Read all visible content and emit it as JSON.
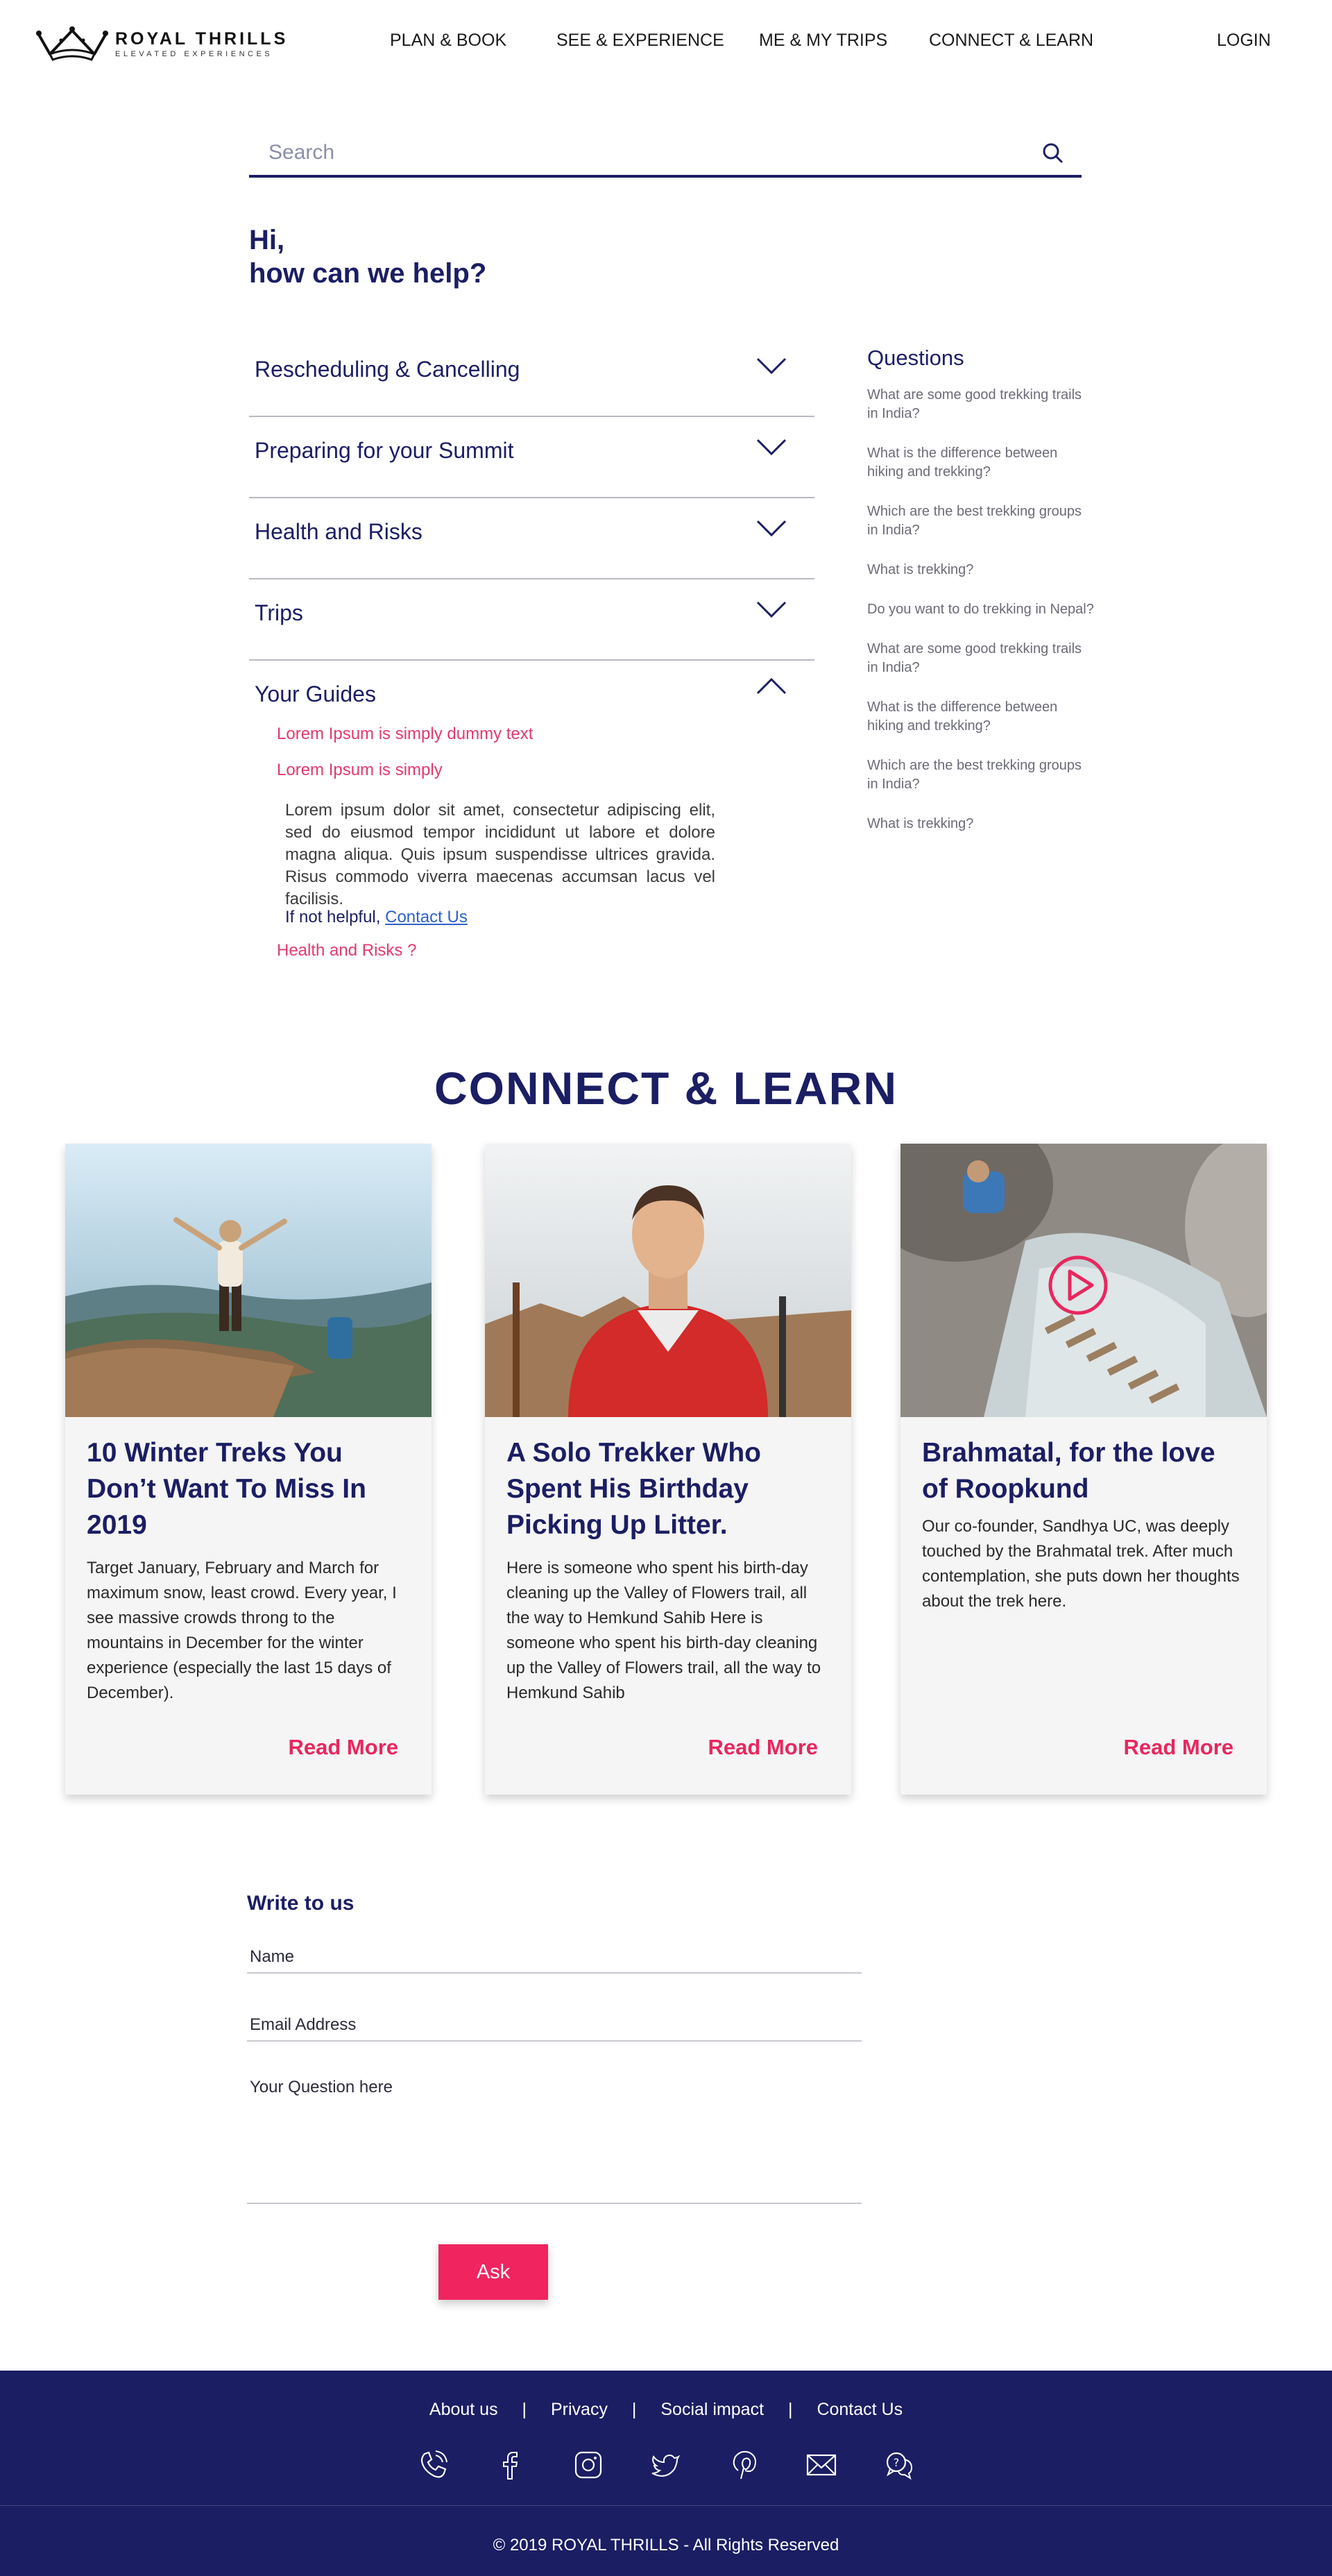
{
  "header": {
    "logo_title": "ROYAL THRILLS",
    "logo_subtitle": "ELEVATED EXPERIENCES",
    "nav": [
      "PLAN & BOOK",
      "SEE & EXPERIENCE",
      "ME & MY TRIPS",
      "CONNECT & LEARN"
    ],
    "login": "LOGIN"
  },
  "search": {
    "placeholder": "Search"
  },
  "greeting": {
    "line1": "Hi,",
    "line2": "how can we help?"
  },
  "faq": {
    "sections": [
      "Rescheduling & Cancelling",
      "Preparing for your Summit",
      "Health and Risks",
      "Trips"
    ],
    "open_section": {
      "label": "Your Guides",
      "sub_questions": [
        "Lorem Ipsum is simply dummy text",
        "Lorem Ipsum is simply"
      ],
      "answer": "Lorem ipsum dolor sit amet, consectetur adipiscing elit, sed do eiusmod tempor incididunt ut labore et dolore magna aliqua. Quis ipsum suspendisse ultrices gravida. Risus commodo viverra maecenas accumsan lacus vel facilisis.",
      "helpful_text": "If not helpful,",
      "contact_link": "Contact Us",
      "related": "Health and Risks ?"
    }
  },
  "questions": {
    "title": "Questions",
    "items": [
      "What are some good trekking trails in India?",
      "What is the difference between hiking and trekking?",
      "Which are the best trekking groups in India?",
      "What is trekking?",
      "Do you want to do trekking in Nepal?",
      "What are some good trekking trails in India?",
      "What is the difference between hiking and trekking?",
      "Which are the best trekking groups in India?",
      "What is trekking?"
    ]
  },
  "connect": {
    "title": "CONNECT & LEARN",
    "cards": [
      {
        "title": "10 Winter Treks You Don’t Want To Miss In 2019",
        "body": "Target January, February and March for maximum snow, least crowd. Every year, I see massive crowds throng to the mountains in December for the winter experience (especially the last 15 days of December).",
        "read_more": "Read More"
      },
      {
        "title": "A Solo Trekker Who Spent His Birthday Picking Up Litter.",
        "body": "Here is someone who spent his birth-day cleaning up the Valley of Flowers trail, all the way to Hemkund Sahib Here is someone who spent his birth-day cleaning up the Valley of Flowers trail, all the way to Hemkund Sahib",
        "read_more": "Read More"
      },
      {
        "title": "Brahmatal, for the love of Roopkund",
        "body": "Our co-founder, Sandhya UC, was deeply touched by the Brahmatal trek. After much contemplation, she puts down her thoughts about the trek here.",
        "read_more": "Read More"
      }
    ]
  },
  "form": {
    "title": "Write to us",
    "name_placeholder": "Name",
    "email_placeholder": "Email Address",
    "question_placeholder": "Your Question here",
    "submit": "Ask"
  },
  "footer": {
    "links": [
      "About us",
      "Privacy",
      "Social impact",
      "Contact Us"
    ],
    "separator": "|",
    "socials": [
      "phone-icon",
      "facebook-icon",
      "instagram-icon",
      "twitter-icon",
      "pinterest-icon",
      "mail-icon",
      "chat-icon"
    ],
    "copyright": "© 2019 ROYAL THRILLS - All Rights Reserved"
  },
  "colors": {
    "brand": "#1b1e63",
    "accent": "#f0245f",
    "link": "#2c62c8"
  }
}
